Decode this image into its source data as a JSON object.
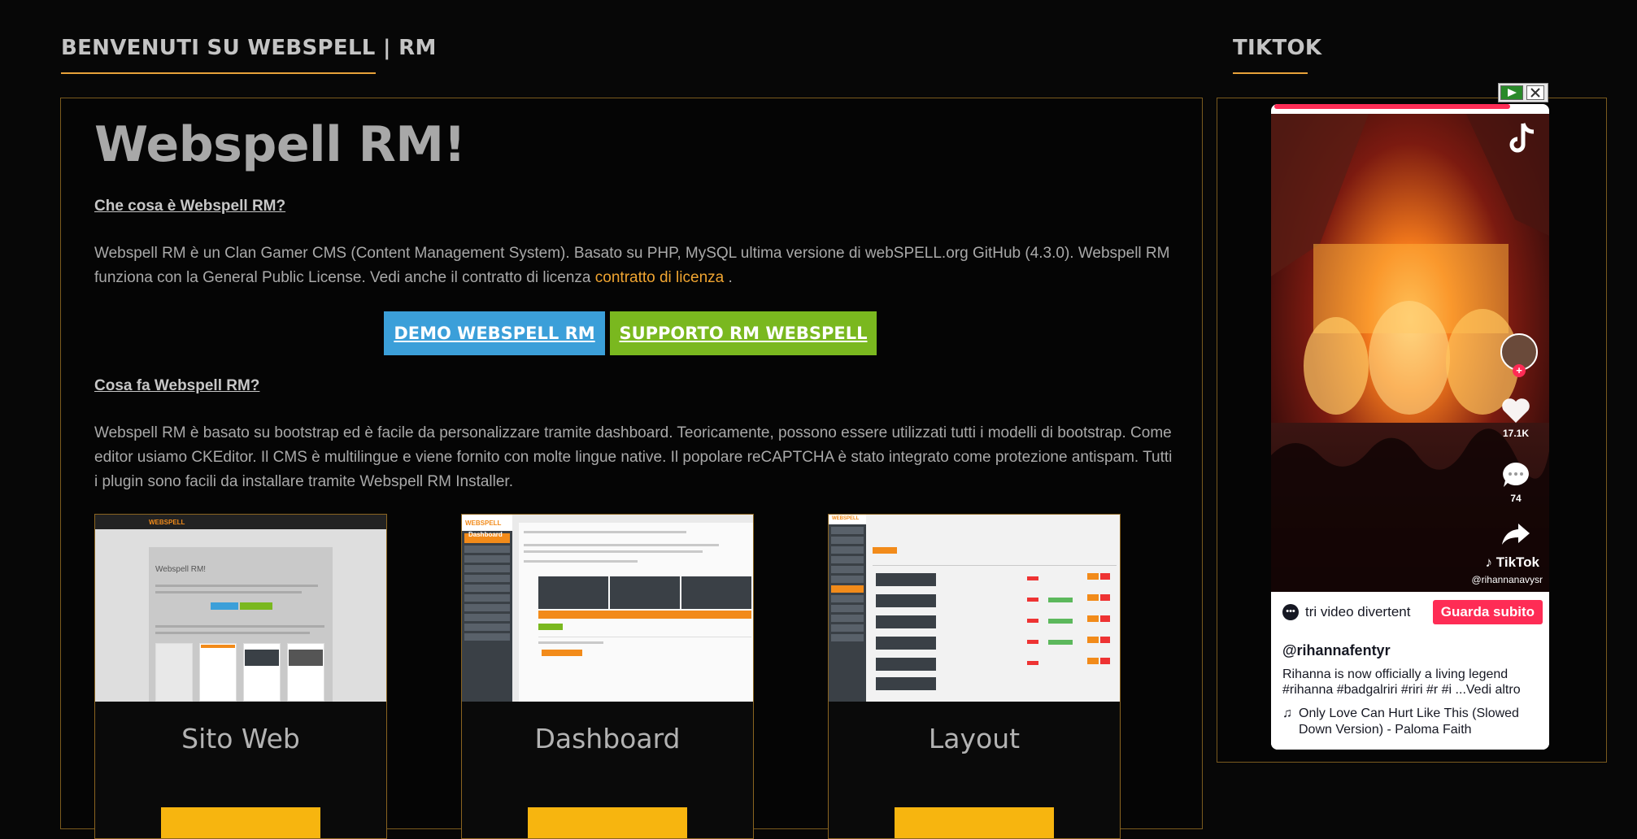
{
  "main_section": {
    "title": "BENVENUTI SU WEBSPELL | RM",
    "hero": "Webspell RM!",
    "q1": "Che cosa è Webspell RM?",
    "p1": "Webspell RM è un Clan Gamer CMS (Content Management System). Basato su PHP, MySQL ultima versione di webSPELL.org GitHub (4.3.0). Webspell RM funziona con la General Public License. Vedi anche il contratto di licenza",
    "p1_link": "contratto di licenza",
    "p1_end": ".",
    "btn_demo": "DEMO WEBSPELL RM",
    "btn_support": "SUPPORTO RM WEBSPELL",
    "q2": "Cosa fa Webspell RM?",
    "p2": "Webspell RM è basato su bootstrap ed è facile da personalizzare tramite dashboard. Teoricamente, possono essere utilizzati tutti i modelli di bootstrap. Come editor usiamo CKEditor. Il CMS è multilingue e viene fornito con molte lingue native. Il popolare reCAPTCHA è stato integrato come protezione antispam. Tutti i plugin sono facili da installare tramite Webspell RM Installer.",
    "cards": [
      {
        "caption": "Sito Web"
      },
      {
        "caption": "Dashboard"
      },
      {
        "caption": "Layout"
      }
    ]
  },
  "mini": {
    "logo": "WEBSPELL",
    "site_heading": "Webspell RM!",
    "dash_heading": "Dashboard"
  },
  "tiktok_section": {
    "title": "TIKTOK",
    "likes": "17.1K",
    "comments": "74",
    "watermark": "TikTok",
    "watermark_user": "@rihannanavysr",
    "more_videos": "tri video divertenti",
    "watch_button": "Guarda subito",
    "username": "@rihannafentyr",
    "description": "Rihanna is now officially a living legend #rihanna #badgalriri #riri #r #i ...Vedi altro",
    "music": "Only Love Can Hurt Like This (Slowed Down Version) - Paloma Faith"
  },
  "colors": {
    "accent": "#e8a23a",
    "demo_button": "#3b9fd9",
    "support_button": "#7ab81f",
    "card_button": "#f7b50f",
    "tiktok_red": "#fe2c55"
  },
  "icons": {
    "play": "play-icon",
    "close": "close-icon",
    "tiktok": "tiktok-logo-icon",
    "heart": "heart-icon",
    "comment": "comment-icon",
    "share": "share-icon",
    "music": "music-note-icon"
  }
}
